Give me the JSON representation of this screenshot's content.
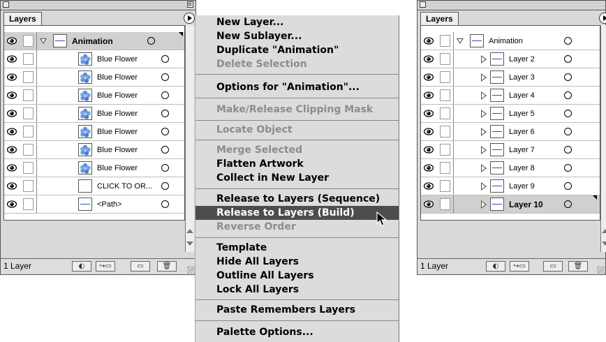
{
  "left_panel": {
    "tab_label": "Layers",
    "rows": [
      {
        "label": "Animation",
        "bold": true
      },
      {
        "label": "Blue Flower"
      },
      {
        "label": "Blue Flower"
      },
      {
        "label": "Blue Flower"
      },
      {
        "label": "Blue Flower"
      },
      {
        "label": "Blue Flower"
      },
      {
        "label": "Blue Flower"
      },
      {
        "label": "Blue Flower"
      },
      {
        "label": "CLICK TO OR..."
      },
      {
        "label": "<Path>"
      }
    ],
    "layer_count": "1 Layer"
  },
  "menu": {
    "items": [
      "New Layer...",
      "New Sublayer...",
      "Duplicate \"Animation\"",
      "Delete Selection",
      "Options for \"Animation\"...",
      "Make/Release Clipping Mask",
      "Locate Object",
      "Merge Selected",
      "Flatten Artwork",
      "Collect in New Layer",
      "Release to Layers (Sequence)",
      "Release to Layers (Build)",
      "Reverse Order",
      "Template",
      "Hide All Layers",
      "Outline All Layers",
      "Lock All Layers",
      "Paste Remembers Layers",
      "Palette Options..."
    ],
    "disabled": [
      "Delete Selection",
      "Make/Release Clipping Mask",
      "Locate Object",
      "Merge Selected",
      "Reverse Order"
    ],
    "highlighted": "Release to Layers (Build)"
  },
  "right_panel": {
    "tab_label": "Layers",
    "rows": [
      {
        "label": "Animation"
      },
      {
        "label": "Layer 2"
      },
      {
        "label": "Layer 3"
      },
      {
        "label": "Layer 4"
      },
      {
        "label": "Layer 5"
      },
      {
        "label": "Layer 6"
      },
      {
        "label": "Layer 7"
      },
      {
        "label": "Layer 8"
      },
      {
        "label": "Layer 9"
      },
      {
        "label": "Layer 10",
        "bold": true
      }
    ],
    "layer_count": "1 Layer"
  },
  "colors": {
    "thumbnail_line": "#2a4fd6",
    "flower": "#5b8fd8",
    "menu_highlight": "#4d4d4d"
  }
}
